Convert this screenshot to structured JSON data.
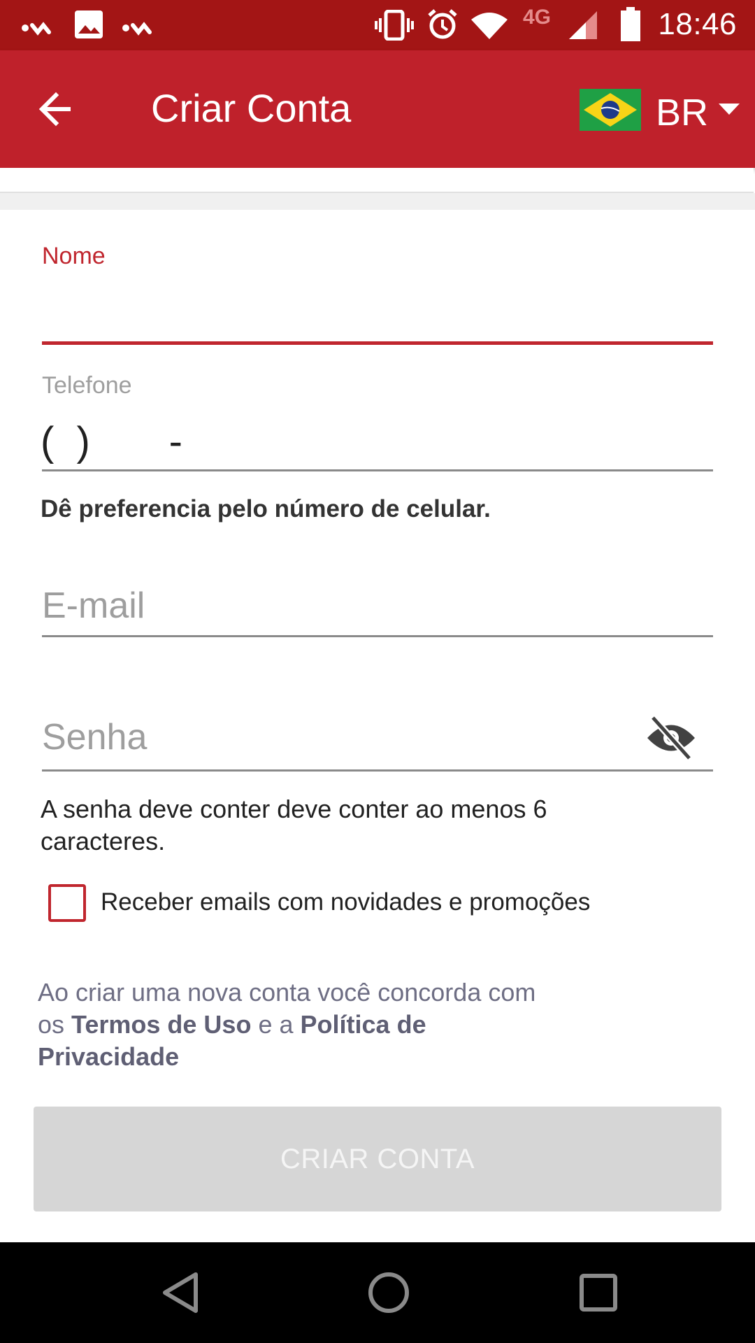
{
  "status_bar": {
    "time": "18:46",
    "network": "4G",
    "icons": [
      "notification-icon",
      "image-icon",
      "notification-icon",
      "vibrate-icon",
      "alarm-icon",
      "wifi-icon",
      "signal-icon",
      "battery-icon"
    ]
  },
  "app_bar": {
    "title": "Criar Conta",
    "back_icon": "arrow-back-icon",
    "country_code": "BR",
    "flag_icon": "brazil-flag-icon",
    "dropdown_icon": "caret-down-icon",
    "color": "#bf212b"
  },
  "form": {
    "nome": {
      "label": "Nome",
      "value": ""
    },
    "telefone": {
      "label": "Telefone",
      "value": "(  )       -",
      "hint": "Dê preferencia pelo número de celular."
    },
    "email": {
      "placeholder": "E-mail",
      "value": ""
    },
    "senha": {
      "placeholder": "Senha",
      "value": "",
      "toggle_icon": "eye-off-icon",
      "hint": "A senha deve conter deve conter ao menos 6 caracteres."
    },
    "newsletter": {
      "label": "Receber emails com novidades e promoções",
      "checked": false
    },
    "terms": {
      "prefix": "Ao criar uma nova conta você concorda com os",
      "terms_link": "Termos de Uso",
      "middle": "e a",
      "privacy_link": "Política de Privacidade"
    },
    "submit_label": "CRIAR CONTA",
    "submit_enabled": false
  },
  "nav_bar": {
    "icons": [
      "back-triangle-icon",
      "home-circle-icon",
      "recents-square-icon"
    ]
  }
}
